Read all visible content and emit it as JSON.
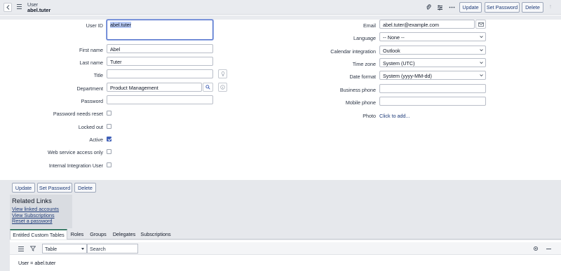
{
  "header": {
    "record_type": "User",
    "record_name": "abel.tuter",
    "buttons": {
      "update": "Update",
      "set_password": "Set Password",
      "delete": "Delete"
    },
    "icons": [
      "paperclip-icon",
      "sliders-icon",
      "more-icon",
      "up-arrow-icon"
    ]
  },
  "form": {
    "user_id": {
      "label": "User ID",
      "value": "abel.tuter"
    },
    "first_name": {
      "label": "First name",
      "value": "Abel"
    },
    "last_name": {
      "label": "Last name",
      "value": "Tuter"
    },
    "title": {
      "label": "Title",
      "value": ""
    },
    "department": {
      "label": "Department",
      "value": "Product Management"
    },
    "password": {
      "label": "Password",
      "value": ""
    },
    "password_needs_reset": {
      "label": "Password needs reset",
      "checked": false
    },
    "locked_out": {
      "label": "Locked out",
      "checked": false
    },
    "active": {
      "label": "Active",
      "checked": true
    },
    "web_service_access_only": {
      "label": "Web service access only",
      "checked": false
    },
    "internal_integration_user": {
      "label": "Internal Integration User",
      "checked": false
    },
    "email": {
      "label": "Email",
      "value": "abel.tuter@example.com"
    },
    "language": {
      "label": "Language",
      "value": "-- None --"
    },
    "calendar_integration": {
      "label": "Calendar integration",
      "value": "Outlook"
    },
    "time_zone": {
      "label": "Time zone",
      "value": "System (UTC)"
    },
    "date_format": {
      "label": "Date format",
      "value": "System (yyyy-MM-dd)"
    },
    "business_phone": {
      "label": "Business phone",
      "value": ""
    },
    "mobile_phone": {
      "label": "Mobile phone",
      "value": ""
    },
    "photo": {
      "label": "Photo",
      "link": "Click to add..."
    }
  },
  "form_buttons": {
    "update": "Update",
    "set_password": "Set Password",
    "delete": "Delete"
  },
  "related_links": {
    "title": "Related Links",
    "items": [
      "View linked accounts",
      "View Subscriptions",
      "Reset a password"
    ]
  },
  "tabs": [
    "Entitled Custom Tables",
    "Roles",
    "Groups",
    "Delegates",
    "Subscriptions"
  ],
  "list": {
    "select_value": "Table",
    "search_placeholder": "Search",
    "filter": "User = abel.tuter"
  },
  "colors": {
    "accent": "#4060b8",
    "button_text": "#1d3a78",
    "active_tab": "#3d7d6a"
  }
}
